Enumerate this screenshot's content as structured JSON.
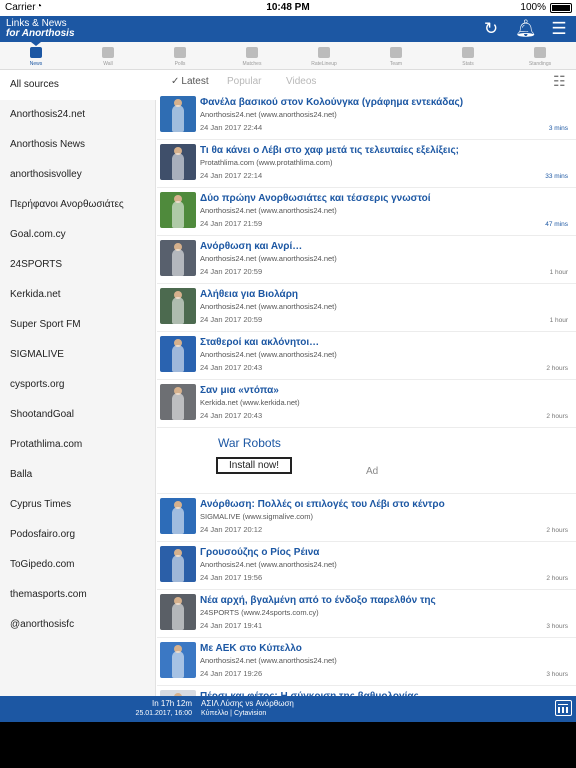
{
  "status_bar": {
    "carrier": "Carrier",
    "time": "10:48 PM",
    "battery": "100%"
  },
  "header": {
    "title_line1": "Links & News",
    "title_line2": "for Anorthosis"
  },
  "tabs": [
    {
      "label": "News",
      "active": true
    },
    {
      "label": "Wall",
      "active": false
    },
    {
      "label": "Polls",
      "active": false
    },
    {
      "label": "Matches",
      "active": false
    },
    {
      "label": "RateLineup",
      "active": false
    },
    {
      "label": "Team",
      "active": false
    },
    {
      "label": "Stats",
      "active": false
    },
    {
      "label": "Standings",
      "active": false
    }
  ],
  "sidebar": {
    "items": [
      {
        "label": "All sources",
        "selected": true
      },
      {
        "label": "Anorthosis24.net"
      },
      {
        "label": "Anorthosis News"
      },
      {
        "label": "anorthosisvolley"
      },
      {
        "label": "Περήφανοι Ανορθωσιάτες"
      },
      {
        "label": "Goal.com.cy"
      },
      {
        "label": "24SPORTS"
      },
      {
        "label": "Kerkida.net"
      },
      {
        "label": "Super Sport FM"
      },
      {
        "label": "SIGMALIVE"
      },
      {
        "label": "cysports.org"
      },
      {
        "label": "ShootandGoal"
      },
      {
        "label": "Protathlima.com"
      },
      {
        "label": "Balla"
      },
      {
        "label": "Cyprus Times"
      },
      {
        "label": "Podosfairo.org"
      },
      {
        "label": "ToGipedo.com"
      },
      {
        "label": "themasports.com"
      },
      {
        "label": "@anorthosisfc"
      }
    ]
  },
  "filters": {
    "latest": "Latest",
    "popular": "Popular",
    "videos": "Videos"
  },
  "feed": [
    {
      "headline": "Φανέλα βασικού στον Κολούνγκα (γράφημα εντεκάδας)",
      "source": "Anorthosis24.net (www.anorthosis24.net)",
      "date": "24 Jan 2017 22:44",
      "ago": "3 mins",
      "recent": true,
      "thumb_color": "#2f6db3"
    },
    {
      "headline": "Τι θα κάνει ο Λέβι στο χαφ μετά τις τελευταίες εξελίξεις;",
      "source": "Protathlima.com (www.protathlima.com)",
      "date": "24 Jan 2017 22:14",
      "ago": "33 mins",
      "recent": true,
      "thumb_color": "#3f4f6a"
    },
    {
      "headline": "Δύο πρώην Ανορθωσιάτες και τέσσερις γνωστοί",
      "source": "Anorthosis24.net (www.anorthosis24.net)",
      "date": "24 Jan 2017 21:59",
      "ago": "47 mins",
      "recent": true,
      "thumb_color": "#4f8a3c"
    },
    {
      "headline": "Ανόρθωση και Ανρί…",
      "source": "Anorthosis24.net (www.anorthosis24.net)",
      "date": "24 Jan 2017 20:59",
      "ago": "1 hour",
      "recent": false,
      "thumb_color": "#58606d"
    },
    {
      "headline": "Αλήθεια για Βιολάρη",
      "source": "Anorthosis24.net (www.anorthosis24.net)",
      "date": "24 Jan 2017 20:59",
      "ago": "1 hour",
      "recent": false,
      "thumb_color": "#4c6a4f"
    },
    {
      "headline": "Σταθεροί και ακλόνητοι…",
      "source": "Anorthosis24.net (www.anorthosis24.net)",
      "date": "24 Jan 2017 20:43",
      "ago": "2 hours",
      "recent": false,
      "thumb_color": "#2a63b0"
    },
    {
      "headline": "Σαν μια «ντόπα»",
      "source": "Kerkida.net (www.kerkida.net)",
      "date": "24 Jan 2017 20:43",
      "ago": "2 hours",
      "recent": false,
      "thumb_color": "#6d6f73"
    },
    {
      "headline": "Ανόρθωση: Πολλές οι επιλογές του Λέβι στο κέντρο",
      "source": "SIGMALIVE (www.sigmalive.com)",
      "date": "24 Jan 2017 20:12",
      "ago": "2 hours",
      "recent": false,
      "thumb_color": "#2d6cb8"
    },
    {
      "headline": "Γρουσούζης ο Ρίος Ρέινα",
      "source": "Anorthosis24.net (www.anorthosis24.net)",
      "date": "24 Jan 2017 19:56",
      "ago": "2 hours",
      "recent": false,
      "thumb_color": "#2b5fa8"
    },
    {
      "headline": "Νέα αρχή, βγαλμένη από το ένδοξο παρελθόν της",
      "source": "24SPORTS (www.24sports.com.cy)",
      "date": "24 Jan 2017 19:41",
      "ago": "3 hours",
      "recent": false,
      "thumb_color": "#5a5f66"
    },
    {
      "headline": "Με ΑΕΚ στο Κύπελλο",
      "source": "Anorthosis24.net (www.anorthosis24.net)",
      "date": "24 Jan 2017 19:26",
      "ago": "3 hours",
      "recent": false,
      "thumb_color": "#3b78c4"
    },
    {
      "headline": "Πέρσι και φέτος: Η σύγκριση της βαθμολογίας",
      "source": "",
      "date": "",
      "ago": "",
      "recent": false,
      "thumb_color": "#d7dbe2"
    }
  ],
  "ad": {
    "title": "War Robots",
    "button": "Install now!",
    "label": "Ad"
  },
  "match_bar": {
    "countdown": "In 17h 12m",
    "datetime": "25.01.2017, 16:00",
    "teams": "ΑΣΙΛ Λύσης vs Ανόρθωση",
    "competition": "Κύπελλο | Cytavision"
  }
}
